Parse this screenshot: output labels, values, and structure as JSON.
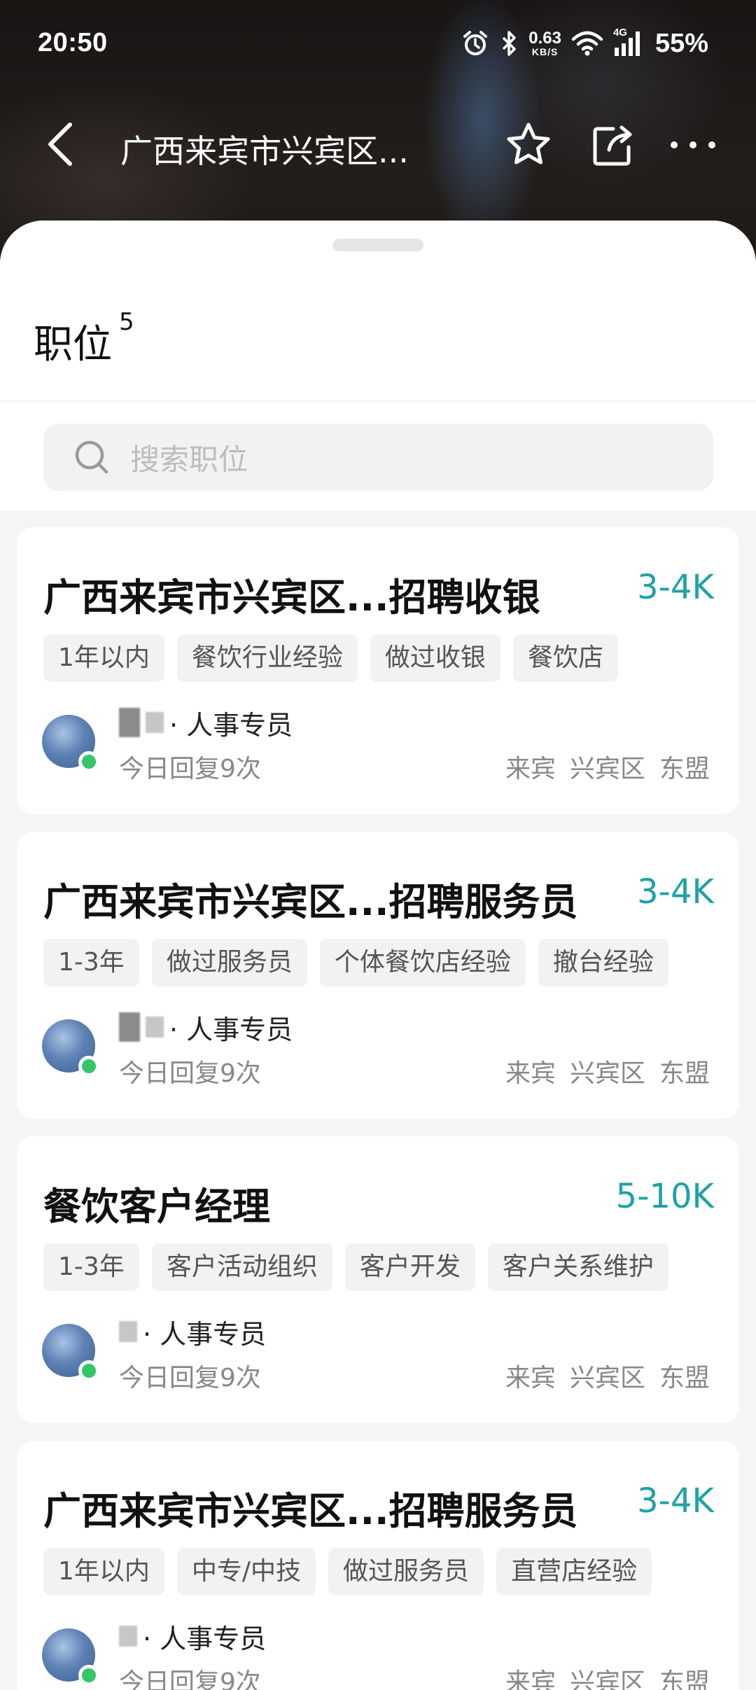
{
  "status_bar": {
    "time": "20:50",
    "net_speed_value": "0.63",
    "net_speed_unit": "KB/S",
    "network_type": "4G",
    "battery": "55%",
    "icons": [
      "alarm-icon",
      "bluetooth-icon",
      "wifi-icon",
      "signal-icon"
    ]
  },
  "nav": {
    "title": "广西来宾市兴宾区...",
    "icons": [
      "back-arrow-icon",
      "star-icon",
      "share-icon",
      "more-icon"
    ]
  },
  "section": {
    "title": "职位",
    "count": "5"
  },
  "search": {
    "placeholder": "搜索职位"
  },
  "colors": {
    "salary": "#1da3a6",
    "online": "#34c66a",
    "tag_bg": "#f2f2f3"
  },
  "jobs": [
    {
      "title": "广西来宾市兴宾区...招聘收银",
      "salary": "3-4K",
      "tags": [
        "1年以内",
        "餐饮行业经验",
        "做过收银",
        "餐饮店"
      ],
      "recruiter_title": "· 人事专员",
      "reply": "今日回复9次",
      "location": [
        "来宾",
        "兴宾区",
        "东盟"
      ]
    },
    {
      "title": "广西来宾市兴宾区...招聘服务员",
      "salary": "3-4K",
      "tags": [
        "1-3年",
        "做过服务员",
        "个体餐饮店经验",
        "撤台经验"
      ],
      "recruiter_title": "· 人事专员",
      "reply": "今日回复9次",
      "location": [
        "来宾",
        "兴宾区",
        "东盟"
      ]
    },
    {
      "title": "餐饮客户经理",
      "salary": "5-10K",
      "tags": [
        "1-3年",
        "客户活动组织",
        "客户开发",
        "客户关系维护"
      ],
      "recruiter_title": "· 人事专员",
      "reply": "今日回复9次",
      "location": [
        "来宾",
        "兴宾区",
        "东盟"
      ]
    },
    {
      "title": "广西来宾市兴宾区...招聘服务员",
      "salary": "3-4K",
      "tags": [
        "1年以内",
        "中专/中技",
        "做过服务员",
        "直营店经验"
      ],
      "recruiter_title": "· 人事专员",
      "reply": "今日回复9次",
      "location": [
        "来宾",
        "兴宾区",
        "东盟"
      ]
    }
  ]
}
